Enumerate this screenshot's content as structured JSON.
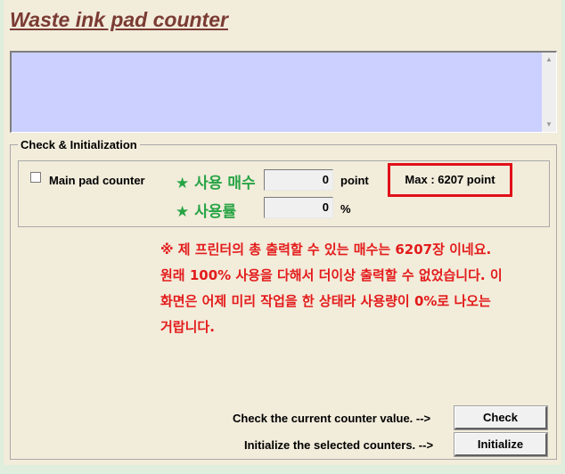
{
  "header": {
    "title": "Waste ink pad counter"
  },
  "group": {
    "legend": "Check & Initialization",
    "main_pad": {
      "checkbox_checked": false,
      "label": "Main pad counter",
      "usage_count_label": "★ 사용 매수",
      "usage_count_value": "0",
      "usage_count_unit": "point",
      "usage_rate_label": "★ 사용률",
      "usage_rate_value": "0",
      "usage_rate_unit": "%",
      "max_label": "Max : 6207 point"
    },
    "note_lines": [
      "※ 제 프린터의 총 출력할 수 있는 매수는 6207장 이네요.",
      "원래 100% 사용을 다해서 더이상 출력할 수 없었습니다. 이",
      "화면은 어제 미리 작업을 한 상태라 사용량이 0%로 나오는",
      "거랍니다."
    ],
    "check_row": {
      "label": "Check the current counter value. -->",
      "button": "Check"
    },
    "init_row": {
      "label": "Initialize the selected counters. -->",
      "button": "Initialize"
    }
  },
  "colors": {
    "title": "#7a3b33",
    "textarea_bg": "#cbd0ff",
    "panel_bg": "#f2ecdb",
    "korean_label": "#27a444",
    "note_text": "#e31b1b",
    "max_border": "#e0101a"
  },
  "icons": {
    "scroll_up": "▲",
    "scroll_down": "▼"
  }
}
